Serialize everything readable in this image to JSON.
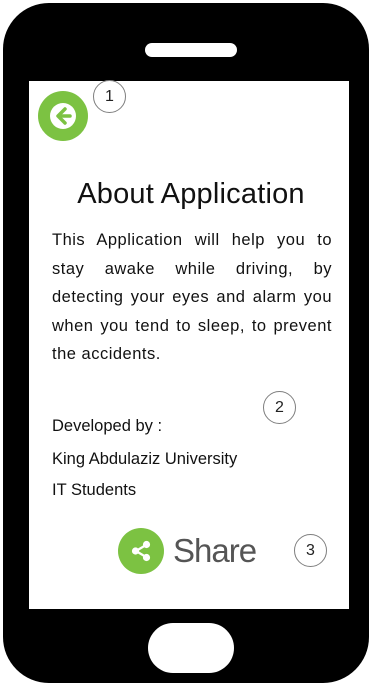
{
  "screen": {
    "title": "About Application",
    "description": "This Application will help you to stay awake while driving, by detecting your eyes and alarm you when you tend to sleep, to prevent the accidents.",
    "developed_by_label": "Developed by :",
    "developer_org": "King Abdulaziz University",
    "developer_team": "IT Students",
    "share_label": "Share"
  },
  "icons": {
    "back": "arrow-left-icon",
    "share": "share-icon"
  },
  "annotations": [
    "1",
    "2",
    "3"
  ],
  "colors": {
    "accent": "#7cc242",
    "phone_body": "#000000",
    "screen_bg": "#ffffff",
    "text": "#111111",
    "share_text": "#555555"
  }
}
